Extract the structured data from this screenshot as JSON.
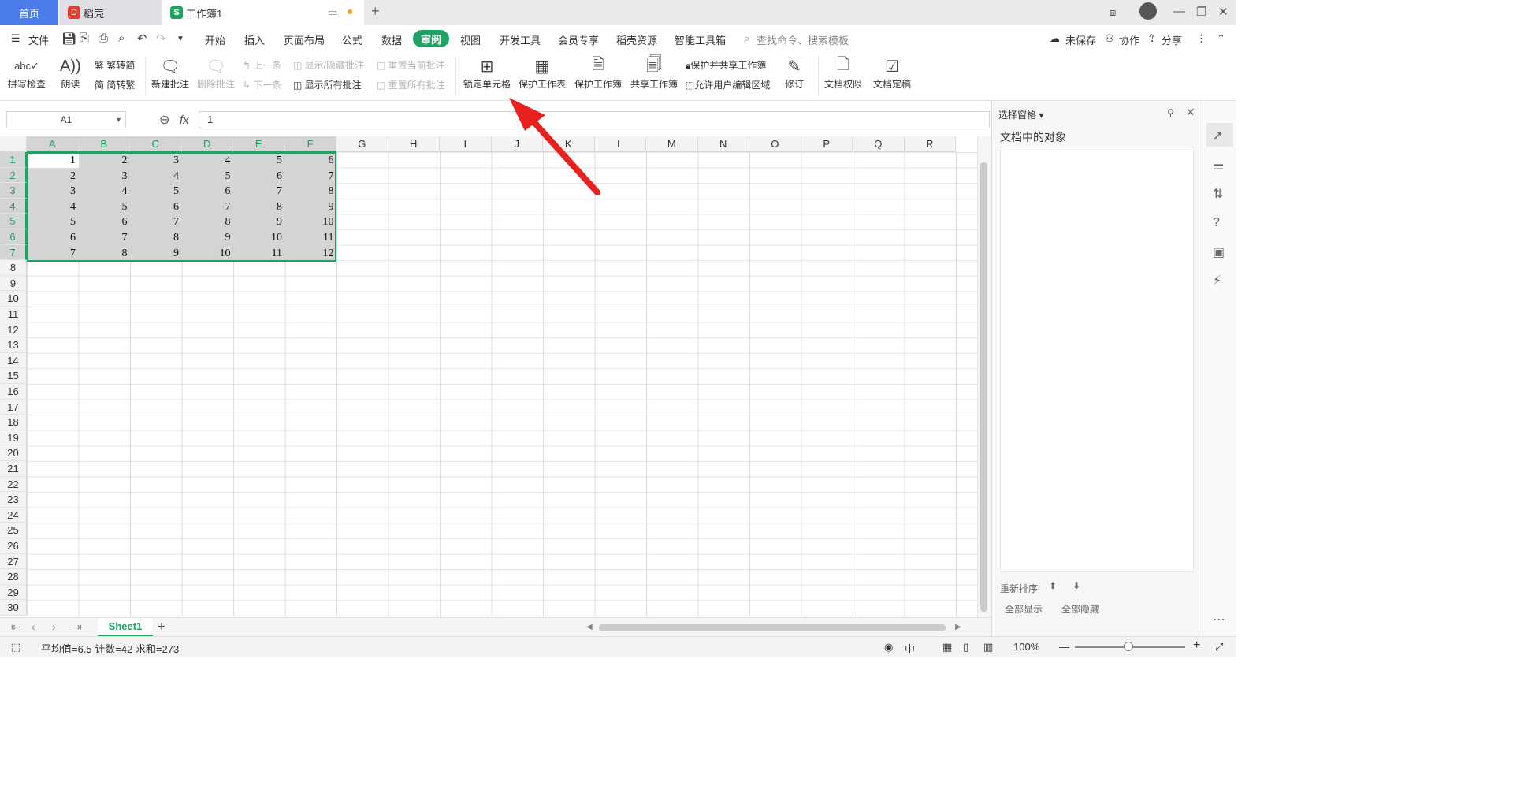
{
  "tabs": {
    "home": "首页",
    "docer": "稻壳",
    "workbook": "工作簿1",
    "docer_logo": "D",
    "sheet_logo": "S"
  },
  "menu": {
    "file": "文件",
    "items": [
      "开始",
      "插入",
      "页面布局",
      "公式",
      "数据",
      "审阅",
      "视图",
      "开发工具",
      "会员专享",
      "稻壳资源",
      "智能工具箱"
    ],
    "active": "审阅",
    "search_placeholder": "查找命令、搜索模板",
    "unsaved": "未保存",
    "collab": "协作",
    "share": "分享"
  },
  "ribbon": {
    "spellcheck": "拼写检查",
    "read": "朗读",
    "trad_simp": "繁转简",
    "simp_trad": "简转繁",
    "new_comment": "新建批注",
    "delete_comment": "删除批注",
    "prev": "上一条",
    "next": "下一条",
    "show_hide_comment": "显示/隐藏批注",
    "show_all_comments": "显示所有批注",
    "reset_current": "重置当前批注",
    "reset_all": "重置所有批注",
    "lock_cell": "锁定单元格",
    "protect_sheet": "保护工作表",
    "protect_book": "保护工作簿",
    "share_book": "共享工作簿",
    "protect_share": "保护并共享工作簿",
    "allow_edit": "允许用户编辑区域",
    "revise": "修订",
    "doc_rights": "文档权限",
    "doc_final": "文档定稿"
  },
  "formula": {
    "cell_ref": "A1",
    "fx": "fx",
    "value": "1"
  },
  "grid": {
    "columns": [
      "A",
      "B",
      "C",
      "D",
      "E",
      "F",
      "G",
      "H",
      "I",
      "J",
      "K",
      "L",
      "M",
      "N",
      "O",
      "P",
      "Q",
      "R"
    ],
    "rows": [
      "1",
      "2",
      "3",
      "4",
      "5",
      "6",
      "7",
      "8",
      "9",
      "10",
      "11",
      "12",
      "13",
      "14",
      "15",
      "16",
      "17",
      "18",
      "19",
      "20",
      "21",
      "22",
      "23",
      "24",
      "25",
      "26",
      "27",
      "28",
      "29",
      "30"
    ],
    "data": [
      [
        "1",
        "2",
        "3",
        "4",
        "5",
        "6"
      ],
      [
        "2",
        "3",
        "4",
        "5",
        "6",
        "7"
      ],
      [
        "3",
        "4",
        "5",
        "6",
        "7",
        "8"
      ],
      [
        "4",
        "5",
        "6",
        "7",
        "8",
        "9"
      ],
      [
        "5",
        "6",
        "7",
        "8",
        "9",
        "10"
      ],
      [
        "6",
        "7",
        "8",
        "9",
        "10",
        "11"
      ],
      [
        "7",
        "8",
        "9",
        "10",
        "11",
        "12"
      ]
    ]
  },
  "sheet": {
    "tab": "Sheet1"
  },
  "status": {
    "stats": "平均值=6.5  计数=42  求和=273",
    "zoom": "100%"
  },
  "pane": {
    "title": "选择窗格",
    "subtitle": "文档中的对象",
    "reorder": "重新排序",
    "show_all": "全部显示",
    "hide_all": "全部隐藏"
  },
  "colors": {
    "accent": "#1fa262",
    "home_tab": "#4a7be8",
    "arrow": "#e8201e"
  }
}
